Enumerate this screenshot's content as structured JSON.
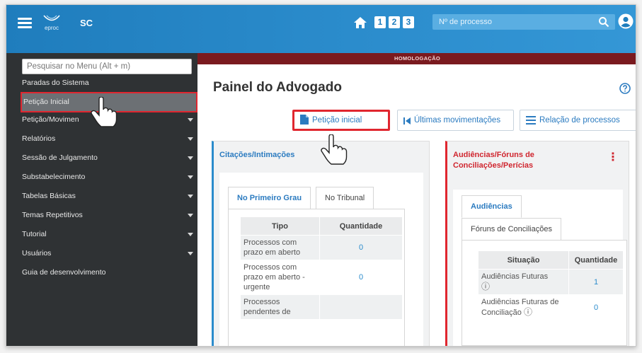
{
  "topbar": {
    "logo_text": "eproc",
    "brand": "SC",
    "num_buttons": [
      "1",
      "2",
      "3"
    ],
    "process_search_placeholder": "Nº de processo"
  },
  "sidebar": {
    "search_placeholder": "Pesquisar no Menu (Alt + m)",
    "items": [
      {
        "label": "Paradas do Sistema"
      },
      {
        "label": "Petição Inicial"
      },
      {
        "label": "Petição/Movimen"
      },
      {
        "label": "Relatórios"
      },
      {
        "label": "Sessão de Julgamento"
      },
      {
        "label": "Substabelecimento"
      },
      {
        "label": "Tabelas Básicas"
      },
      {
        "label": "Temas Repetitivos"
      },
      {
        "label": "Tutorial"
      },
      {
        "label": "Usuários"
      },
      {
        "label": "Guia de desenvolvimento"
      }
    ]
  },
  "main": {
    "env_banner": "HOMOLOGAÇÃO",
    "title": "Painel do Advogado",
    "actions": {
      "peticao": "Petição inicial",
      "ultimas": "Últimas movimentações",
      "relacao": "Relação de processos"
    },
    "citacoes": {
      "title": "Citações/Intimações",
      "tabs": [
        "No Primeiro Grau",
        "No Tribunal"
      ],
      "headers": [
        "Tipo",
        "Quantidade"
      ],
      "rows": [
        {
          "tipo": "Processos com prazo em aberto",
          "qtd": "0"
        },
        {
          "tipo": "Processos com prazo em aberto - urgente",
          "qtd": "0"
        },
        {
          "tipo": "Processos pendentes de",
          "qtd": ""
        }
      ]
    },
    "audiencias": {
      "title": "Audiências/Fóruns de Conciliações/Perícias",
      "tabs": [
        "Audiências",
        "Fóruns de Conciliações"
      ],
      "headers": [
        "Situação",
        "Quantidade"
      ],
      "rows": [
        {
          "situacao": "Audiências Futuras",
          "qtd": "1"
        },
        {
          "situacao": "Audiências Futuras de Conciliação",
          "qtd": "0"
        }
      ]
    }
  }
}
